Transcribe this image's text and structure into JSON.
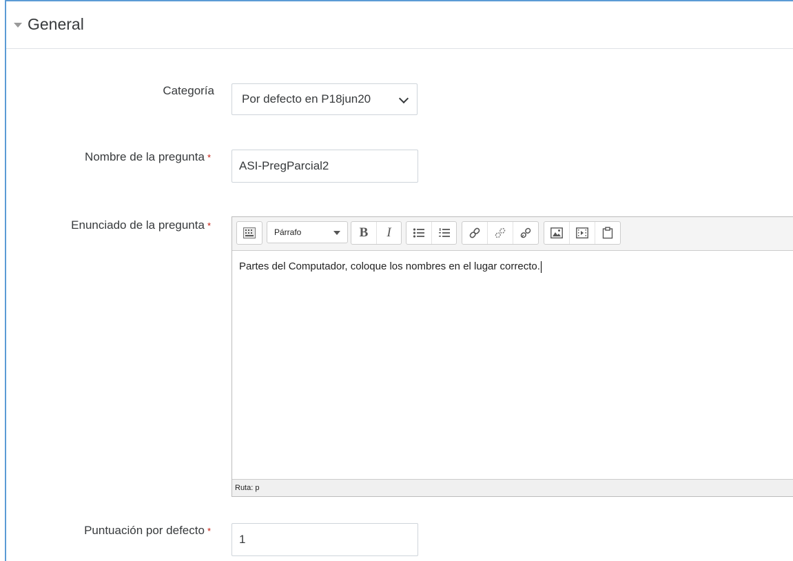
{
  "section": {
    "title": "General",
    "toggle_icon": "caret-down-icon"
  },
  "fields": {
    "category": {
      "label": "Categoría",
      "value": "Por defecto en P18jun20"
    },
    "question_name": {
      "label": "Nombre de la pregunta",
      "required_mark": "*",
      "value": "ASI-PregParcial2"
    },
    "question_text": {
      "label": "Enunciado de la pregunta",
      "required_mark": "*",
      "content": "Partes del Computador, coloque los nombres en el lugar correcto.",
      "path": "Ruta: p"
    },
    "default_mark": {
      "label": "Puntuación por defecto",
      "required_mark": "*",
      "value": "1"
    }
  },
  "editor_toolbar": {
    "paragraph_label": "Párrafo",
    "bold_label": "B",
    "italic_label": "I",
    "icons": [
      "toolbar-toggle-icon",
      "unordered-list-icon",
      "ordered-list-icon",
      "link-icon",
      "unlink-icon",
      "anchor-link-icon",
      "image-icon",
      "media-icon",
      "manage-files-icon"
    ]
  },
  "colors": {
    "required": "#c2170a",
    "frame_accent": "#5b9bd5"
  }
}
